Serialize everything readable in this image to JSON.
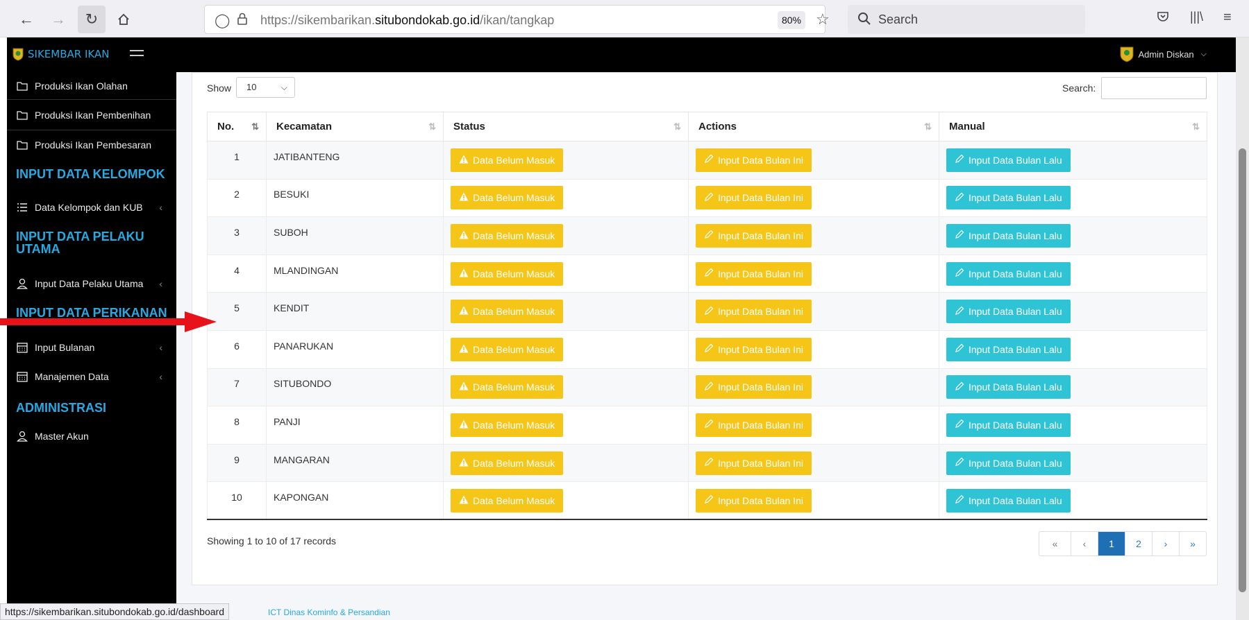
{
  "browser": {
    "url_prefix": "https://sikembarikan.",
    "url_domain": "situbondokab.go.id",
    "url_path": "/ikan/tangkap",
    "zoom": "80%",
    "search_placeholder": "Search",
    "status_url": "https://sikembarikan.situbondokab.go.id/dashboard"
  },
  "app": {
    "brand": "SIKEMBAR IKAN",
    "user": "Admin Diskan",
    "footer_credit": "ICT Dinas Kominfo & Persandian"
  },
  "sidebar": {
    "items_top": [
      {
        "label": "Produksi Ikan Olahan"
      },
      {
        "label": "Produksi Ikan Pembenihan"
      },
      {
        "label": "Produksi Ikan Pembesaran"
      }
    ],
    "head_kelompok": "INPUT DATA KELOMPOK",
    "item_kelompok": "Data Kelompok dan KUB",
    "head_pelaku": "INPUT DATA PELAKU UTAMA",
    "item_pelaku": "Input Data Pelaku Utama",
    "head_perikanan": "INPUT DATA PERIKANAN",
    "item_bulanan": "Input Bulanan",
    "item_manajemen": "Manajemen Data",
    "head_admin": "ADMINISTRASI",
    "item_master": "Master Akun"
  },
  "table_controls": {
    "show_label": "Show",
    "show_value": "10",
    "search_label": "Search:",
    "showing": "Showing 1 to 10 of 17 records"
  },
  "table": {
    "headers": [
      "No.",
      "Kecamatan",
      "Status",
      "Actions",
      "Manual"
    ],
    "status_label": "Data Belum Masuk",
    "action_label": "Input Data Bulan Ini",
    "manual_label": "Input Data Bulan Lalu",
    "rows": [
      {
        "no": "1",
        "kecamatan": "JATIBANTENG"
      },
      {
        "no": "2",
        "kecamatan": "BESUKI"
      },
      {
        "no": "3",
        "kecamatan": "SUBOH"
      },
      {
        "no": "4",
        "kecamatan": "MLANDINGAN"
      },
      {
        "no": "5",
        "kecamatan": "KENDIT"
      },
      {
        "no": "6",
        "kecamatan": "PANARUKAN"
      },
      {
        "no": "7",
        "kecamatan": "SITUBONDO"
      },
      {
        "no": "8",
        "kecamatan": "PANJI"
      },
      {
        "no": "9",
        "kecamatan": "MANGARAN"
      },
      {
        "no": "10",
        "kecamatan": "KAPONGAN"
      }
    ]
  },
  "pagination": {
    "first": "«",
    "prev": "‹",
    "page1": "1",
    "page2": "2",
    "next": "›",
    "last": "»"
  },
  "colors": {
    "accent": "#27a9e1",
    "warning": "#f5c518",
    "info": "#2ec4d6",
    "annotation_arrow": "#e8121a"
  }
}
